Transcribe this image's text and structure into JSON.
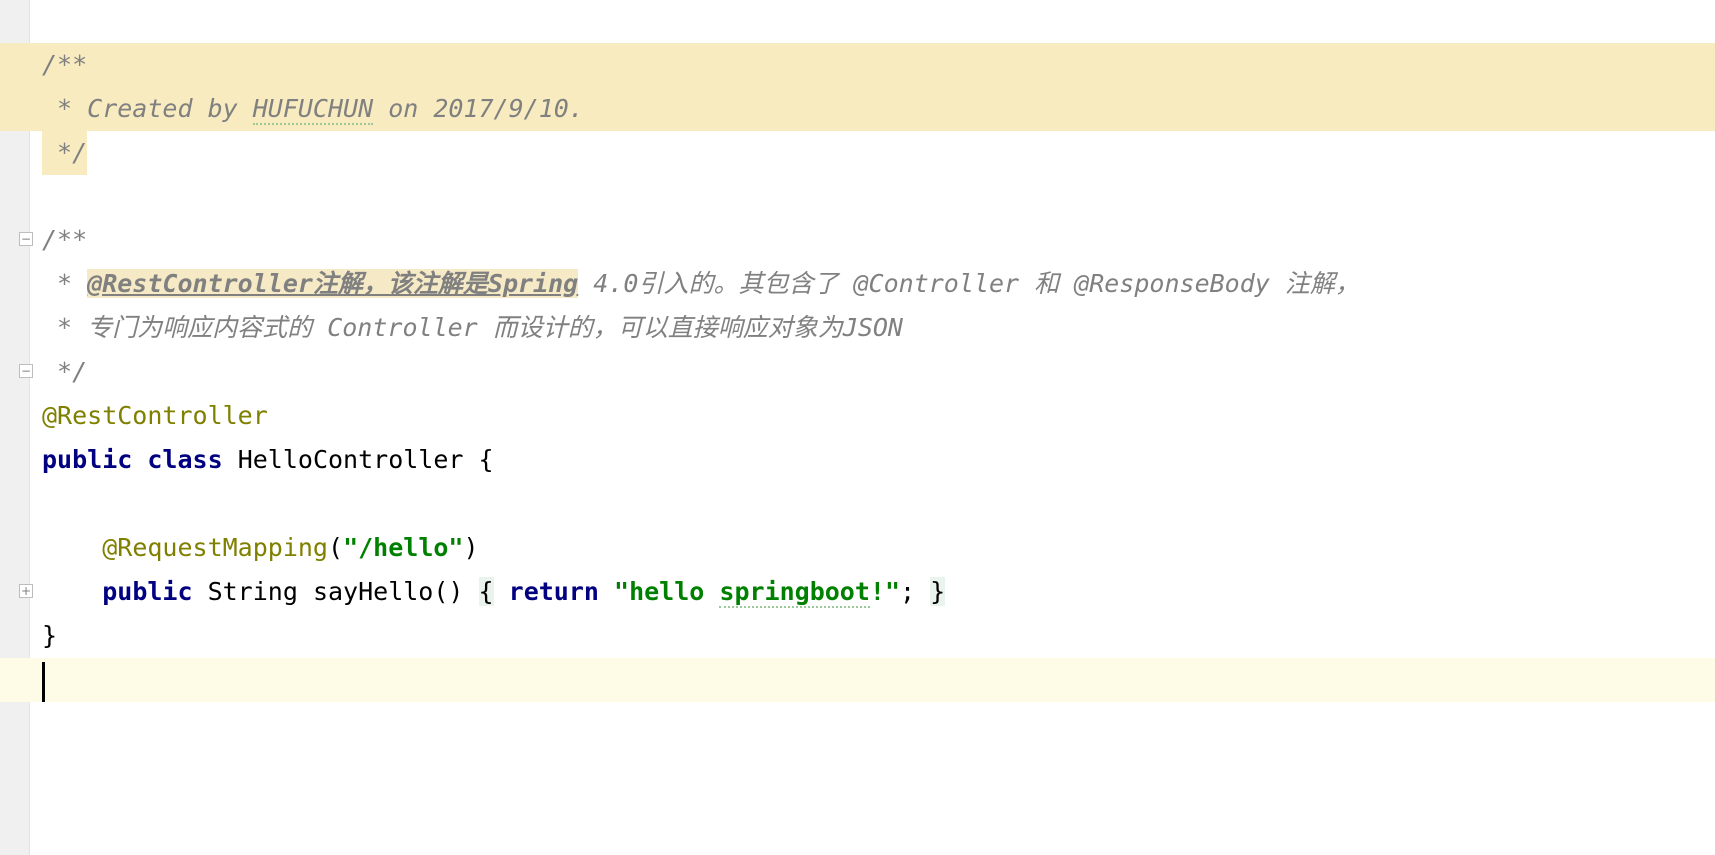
{
  "editor": {
    "header_comment": {
      "open": "/**",
      "created_prefix": " * Created by ",
      "author": "HUFUCHUN",
      "created_suffix": " on 2017/9/10.",
      "close": " */"
    },
    "doc_comment": {
      "open": "/**",
      "line1_star": " * ",
      "line1_tag": "@RestController注解，该注解是Spring",
      "line1_rest": " 4.0引入的。其包含了 @Controller 和 @ResponseBody 注解，",
      "line2": " * 专门为响应内容式的 Controller 而设计的，可以直接响应对象为JSON",
      "close": " */"
    },
    "class_annotation": "@RestController",
    "class_decl": {
      "kw_public": "public",
      "kw_class": "class",
      "name": " HelloController {"
    },
    "method_annotation": {
      "name": "@RequestMapping",
      "open": "(",
      "value": "\"/hello\"",
      "close": ")"
    },
    "method_decl": {
      "kw_public": "public",
      "signature": " String sayHello()",
      "open_brace": "{",
      "kw_return": "return",
      "str_open": "\"hello ",
      "str_word": "springboot",
      "str_close": "!\"",
      "semicolon": ";",
      "close_brace": "}"
    },
    "class_close": "}",
    "fold_collapsed_glyph": "+",
    "fold_expanded_glyph": "−"
  }
}
